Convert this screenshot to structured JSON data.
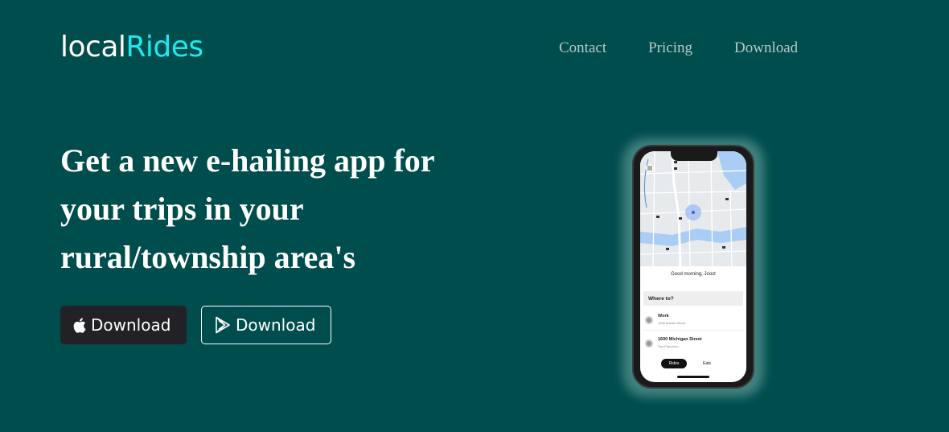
{
  "brand": {
    "part1": "local",
    "part2": "Rides"
  },
  "nav": {
    "items": [
      "Contact",
      "Pricing",
      "Download"
    ]
  },
  "hero": {
    "headline": "Get a new e-hailing app for your trips in your rural/township area's"
  },
  "buttons": {
    "ios_label": "Download",
    "play_label": "Download"
  },
  "phone": {
    "greeting": "Good morning, Joost",
    "where_to": "Where to?",
    "saved_places": [
      {
        "title": "Work",
        "subtitle": "1455 Market Street"
      },
      {
        "title": "1600 Michigan Street",
        "subtitle": "San Francisco"
      }
    ],
    "tabs": [
      "Rides",
      "Eats"
    ]
  },
  "colors": {
    "background": "#004d4d",
    "accent": "#1ee8ef",
    "button_dark": "#222226"
  },
  "icons": {
    "ios": "apple-icon",
    "play": "google-play-icon"
  }
}
